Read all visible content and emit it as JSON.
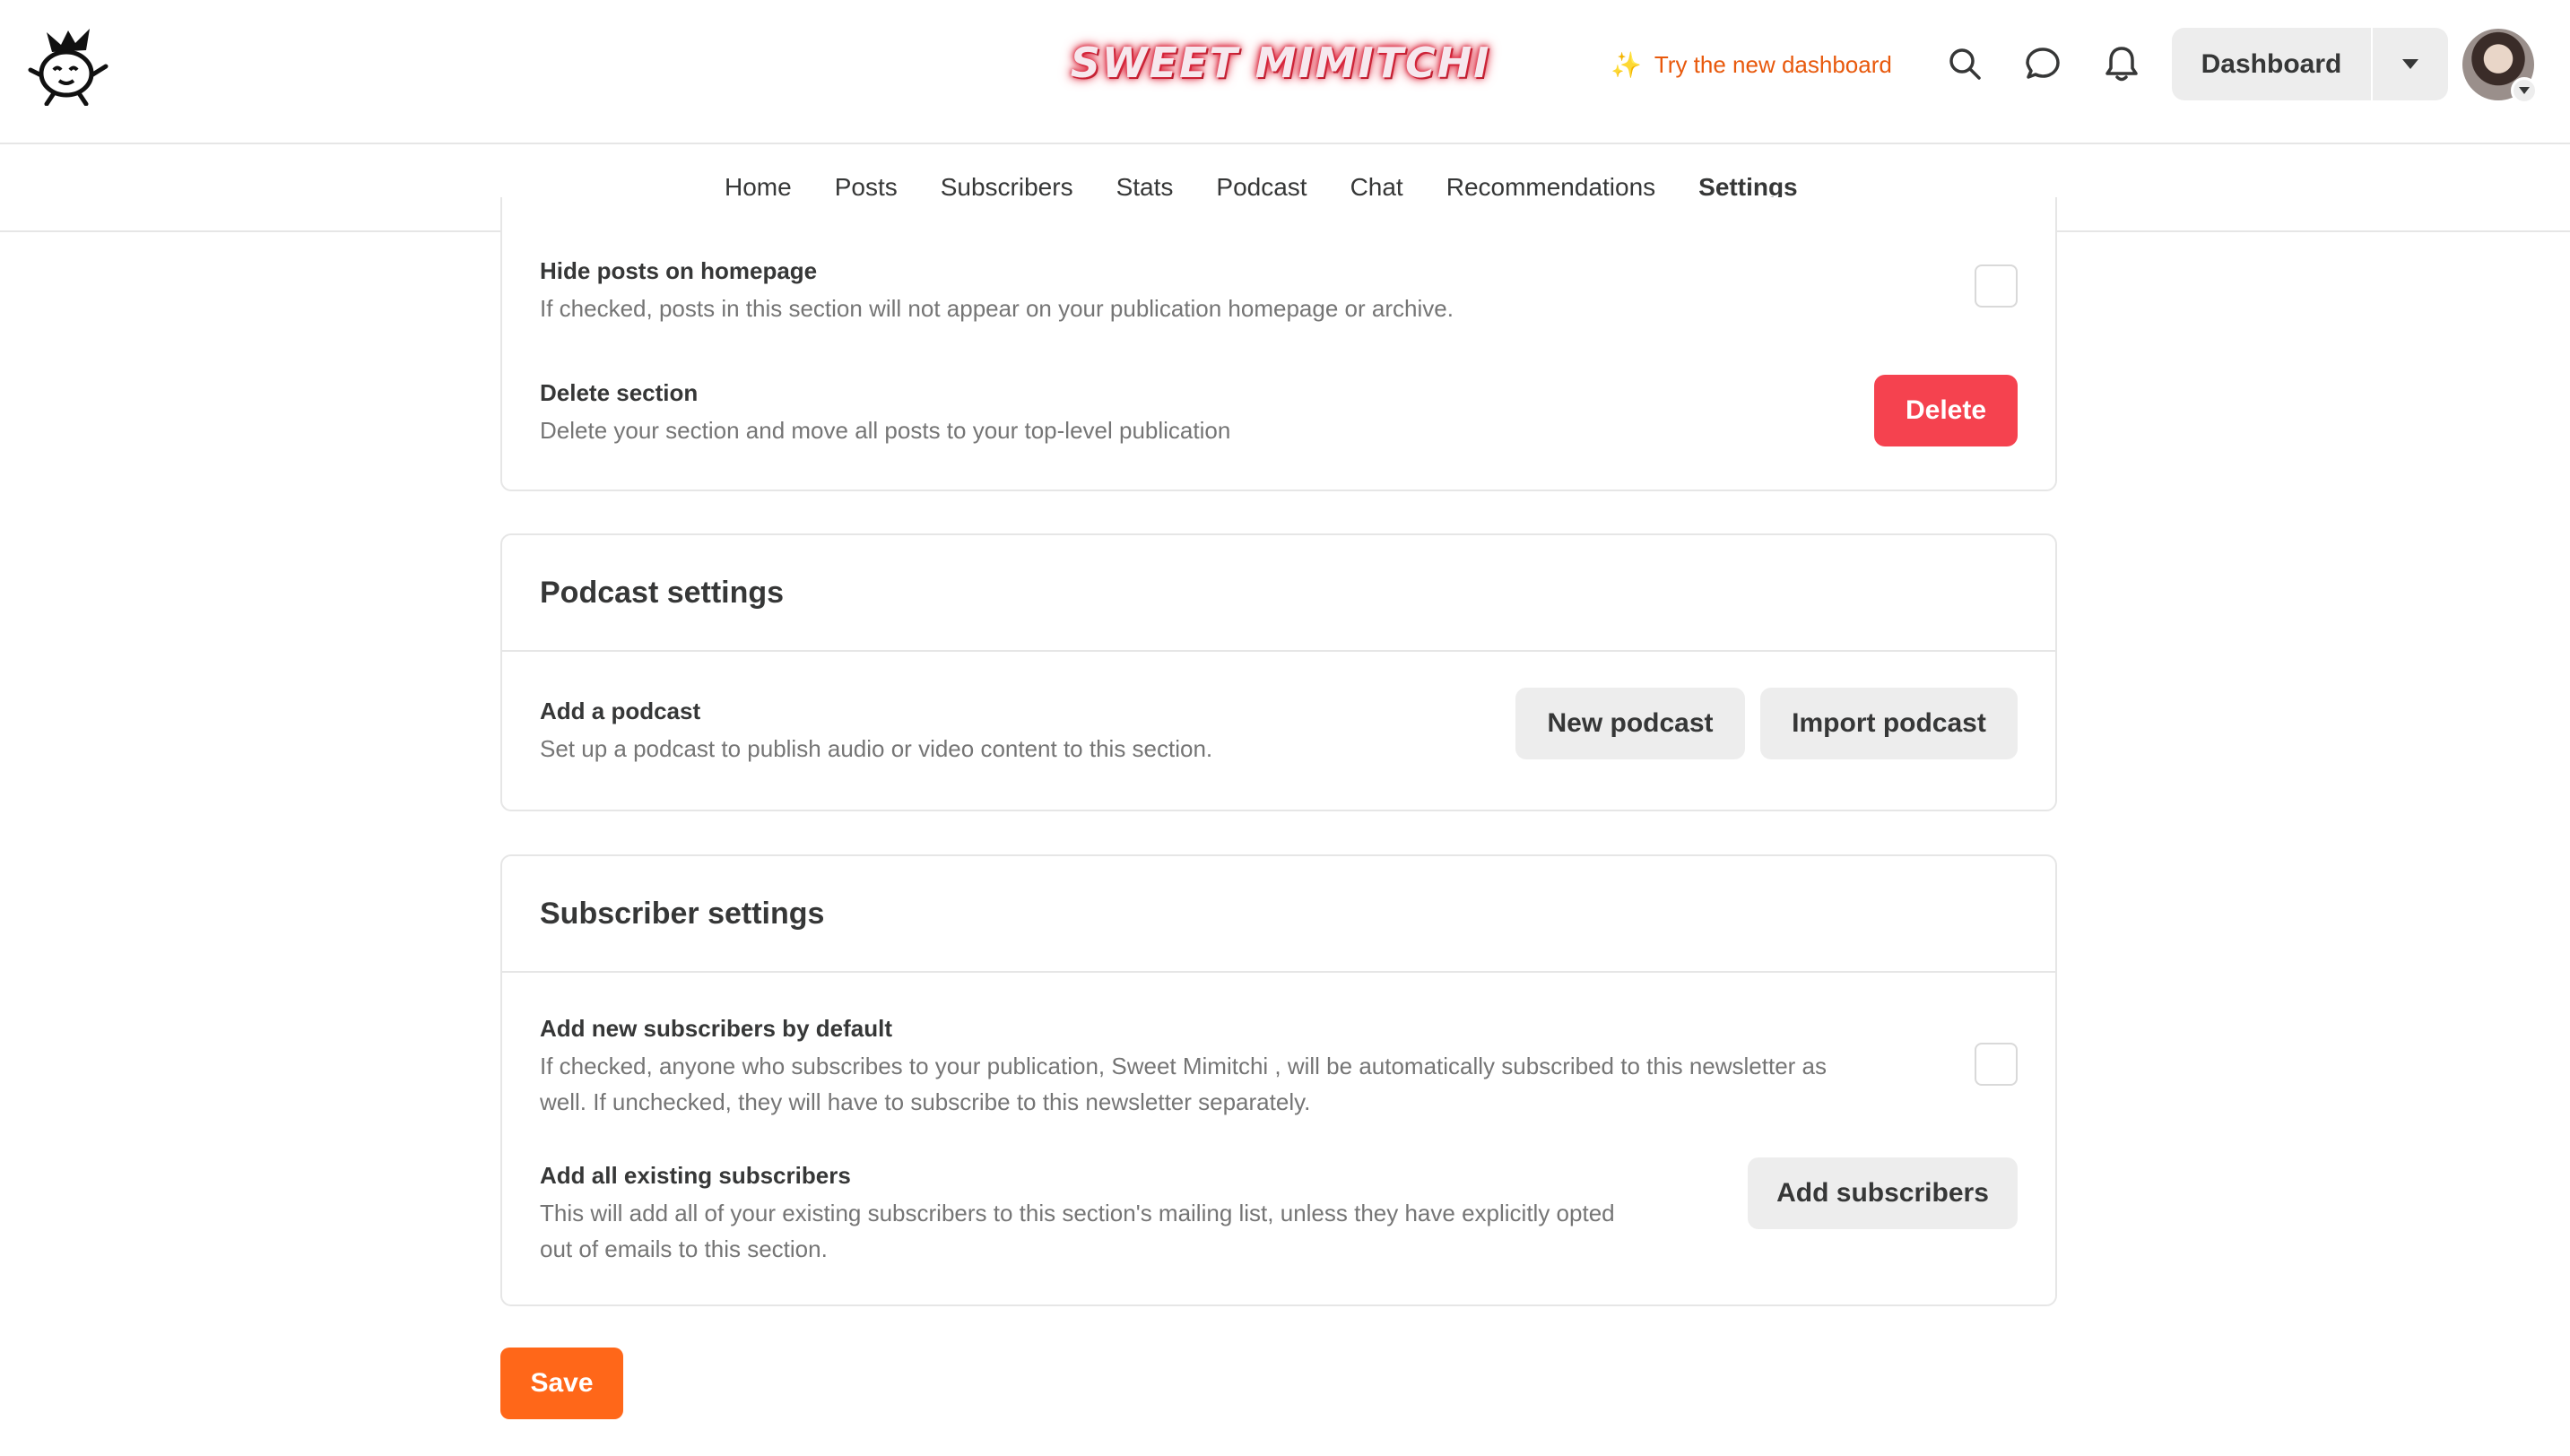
{
  "header": {
    "wordmark": "SWEET MIMITCHI",
    "try_new_dashboard": "Try the new dashboard",
    "dashboard_label": "Dashboard"
  },
  "tabs": [
    {
      "label": "Home"
    },
    {
      "label": "Posts"
    },
    {
      "label": "Subscribers"
    },
    {
      "label": "Stats"
    },
    {
      "label": "Podcast"
    },
    {
      "label": "Chat"
    },
    {
      "label": "Recommendations"
    },
    {
      "label": "Settings",
      "active": true
    }
  ],
  "section_settings": {
    "hide_posts": {
      "title": "Hide posts on homepage",
      "description": "If checked, posts in this section will not appear on your publication homepage or archive.",
      "checked": false
    },
    "delete_section": {
      "title": "Delete section",
      "description": "Delete your section and move all posts to your top-level publication",
      "button": "Delete"
    }
  },
  "podcast_settings": {
    "heading": "Podcast settings",
    "add_podcast": {
      "title": "Add a podcast",
      "description": "Set up a podcast to publish audio or video content to this section.",
      "new_button": "New podcast",
      "import_button": "Import podcast"
    }
  },
  "subscriber_settings": {
    "heading": "Subscriber settings",
    "add_new_default": {
      "title": "Add new subscribers by default",
      "description_line1": "If checked, anyone who subscribes to your publication, Sweet Mimitchi , will be automatically subscribed to this newsletter as",
      "description_line2": "well. If unchecked, they will have to subscribe to this newsletter separately.",
      "checked": false
    },
    "add_existing": {
      "title": "Add all existing subscribers",
      "description_line1": "This will add all of your existing subscribers to this section's mailing list, unless they have explicitly opted",
      "description_line2": "out of emails to this section.",
      "button": "Add subscribers"
    }
  },
  "footer": {
    "save_label": "Save"
  },
  "colors": {
    "accent_orange": "#ff6719",
    "delete_red": "#f5424f",
    "try_new_orange": "#e8590c"
  },
  "icons": [
    "mascot-logo-icon",
    "sparkle-icon",
    "search-icon",
    "chat-bubble-icon",
    "bell-icon",
    "caret-down-icon"
  ]
}
